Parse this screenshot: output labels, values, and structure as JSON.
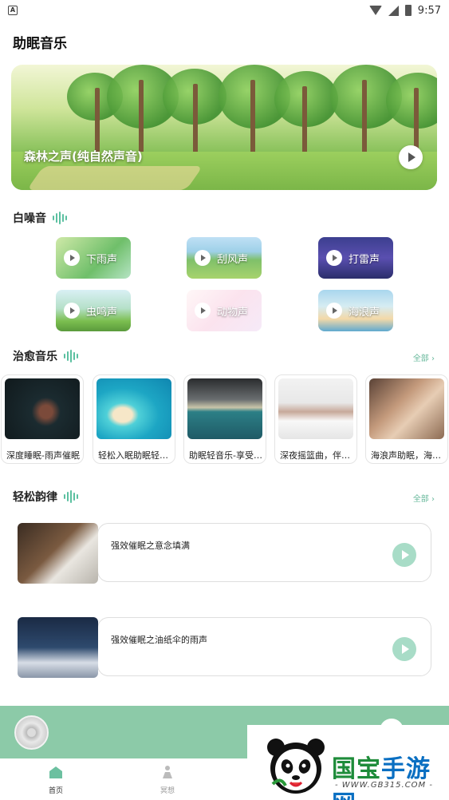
{
  "status_bar": {
    "time": "9:57"
  },
  "page_title": "助眠音乐",
  "banner": {
    "title": "森林之声(纯自然声音)"
  },
  "white_noise": {
    "heading": "白噪音",
    "items": [
      {
        "label": "下雨声"
      },
      {
        "label": "刮风声"
      },
      {
        "label": "打雷声"
      },
      {
        "label": "虫鸣声"
      },
      {
        "label": "动物声"
      },
      {
        "label": "海浪声"
      }
    ]
  },
  "healing_music": {
    "heading": "治愈音乐",
    "more": "全部",
    "items": [
      {
        "title": "深度睡眠-雨声催眠"
      },
      {
        "title": "轻松入眠助眠轻音乐"
      },
      {
        "title": "助眠轻音乐-享受宁静"
      },
      {
        "title": "深夜摇篮曲，伴你入眠"
      },
      {
        "title": "海浪声助眠，海边的"
      }
    ]
  },
  "relaxing": {
    "heading": "轻松韵律",
    "more": "全部",
    "items": [
      {
        "title": "强效催眠之意念填满"
      },
      {
        "title": "强效催眠之油纸伞的雨声"
      }
    ]
  },
  "tabs": [
    {
      "label": "首页"
    },
    {
      "label": "冥想"
    }
  ],
  "watermark": {
    "brand_1": "国宝",
    "brand_2": "手游网",
    "url": "- WWW.GB315.COM -"
  },
  "colors": {
    "accent": "#5bc0a0",
    "player_bar": "#8ccaa8"
  }
}
